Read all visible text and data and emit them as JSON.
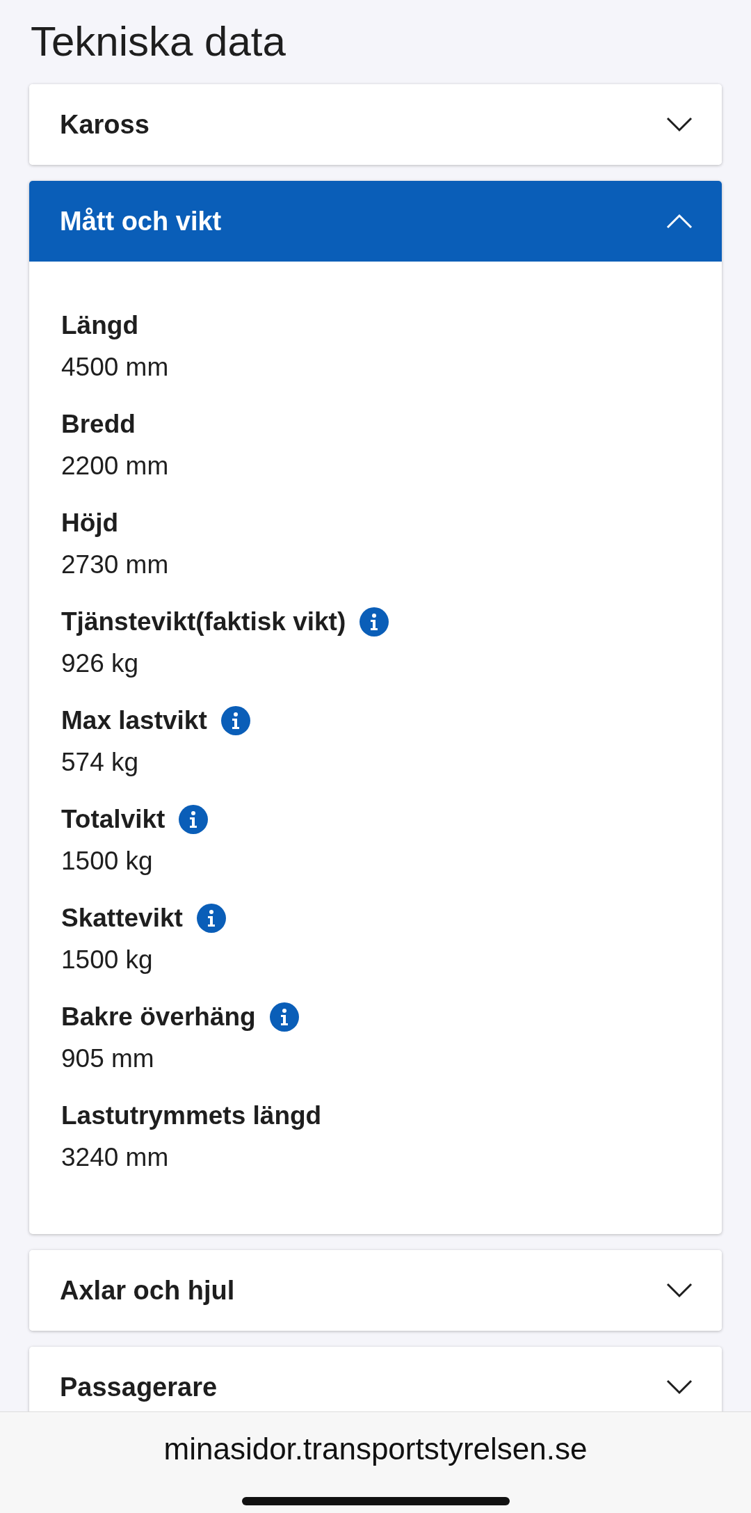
{
  "page_title": "Tekniska data",
  "sections": [
    {
      "title": "Kaross",
      "expanded": false
    },
    {
      "title": "Mått och vikt",
      "expanded": true,
      "fields": [
        {
          "label": "Längd",
          "value": "4500 mm",
          "info": false
        },
        {
          "label": "Bredd",
          "value": "2200 mm",
          "info": false
        },
        {
          "label": "Höjd",
          "value": "2730 mm",
          "info": false
        },
        {
          "label": "Tjänstevikt(faktisk vikt)",
          "value": "926 kg",
          "info": true
        },
        {
          "label": "Max lastvikt",
          "value": "574 kg",
          "info": true
        },
        {
          "label": "Totalvikt",
          "value": "1500 kg",
          "info": true
        },
        {
          "label": "Skattevikt",
          "value": "1500 kg",
          "info": true
        },
        {
          "label": "Bakre överhäng",
          "value": "905 mm",
          "info": true
        },
        {
          "label": "Lastutrymmets längd",
          "value": "3240 mm",
          "info": false
        }
      ]
    },
    {
      "title": "Axlar och hjul",
      "expanded": false
    },
    {
      "title": "Passagerare",
      "expanded": false
    }
  ],
  "browser_bar": {
    "url": "minasidor.transportstyrelsen.se"
  }
}
